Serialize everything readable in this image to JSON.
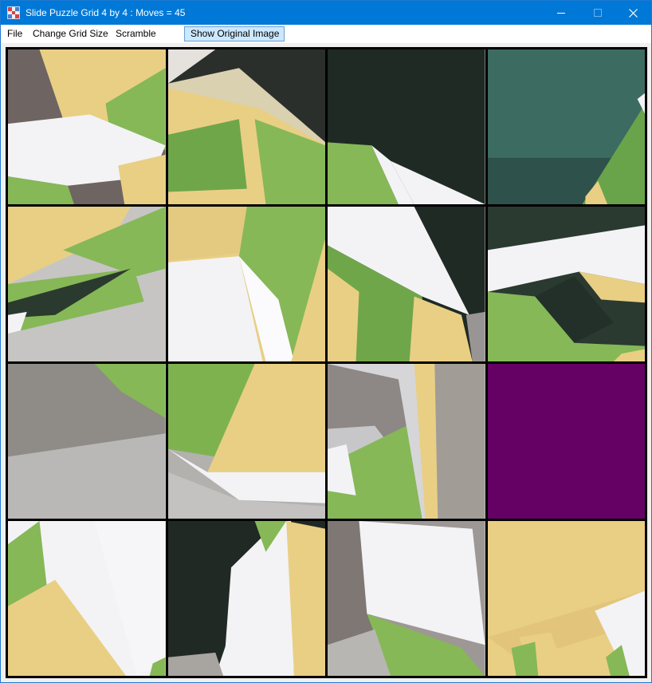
{
  "window": {
    "title": "Slide Puzzle Grid 4 by 4 : Moves = 45",
    "minimize_glyph": "—",
    "maximize_glyph": "☐",
    "close_glyph": "✕"
  },
  "menu": {
    "file": "File",
    "change_grid_size": "Change Grid Size",
    "scramble": "Scramble",
    "show_original": "Show Original Image"
  },
  "puzzle": {
    "rows": 4,
    "columns": 4,
    "moves": 45,
    "empty_tile": {
      "row": 3,
      "column": 4,
      "color": "#650065"
    }
  },
  "colors": {
    "titlebar": "#0078d7",
    "paper_yellow": "#e9cf84",
    "paper_green": "#86b857",
    "paper_white": "#f3f3f6",
    "dark_background": "#1f2a24",
    "teal_background": "#3c6b62",
    "grey_background": "#a6a39f"
  }
}
